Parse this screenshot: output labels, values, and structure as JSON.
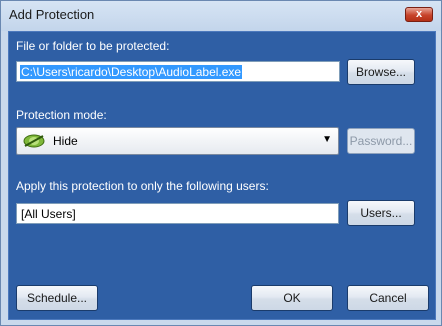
{
  "window": {
    "title": "Add Protection",
    "close_glyph": "x"
  },
  "file": {
    "label": "File or folder to be protected:",
    "value": "C:\\Users\\ricardo\\Desktop\\AudioLabel.exe",
    "browse_label": "Browse..."
  },
  "mode": {
    "label": "Protection mode:",
    "selected": "Hide",
    "icon": "eye-hidden-icon",
    "password_label": "Password..."
  },
  "users": {
    "label": "Apply this protection to only the following users:",
    "value": "[All Users]",
    "users_label": "Users..."
  },
  "footer": {
    "schedule_label": "Schedule...",
    "ok_label": "OK",
    "cancel_label": "Cancel"
  }
}
